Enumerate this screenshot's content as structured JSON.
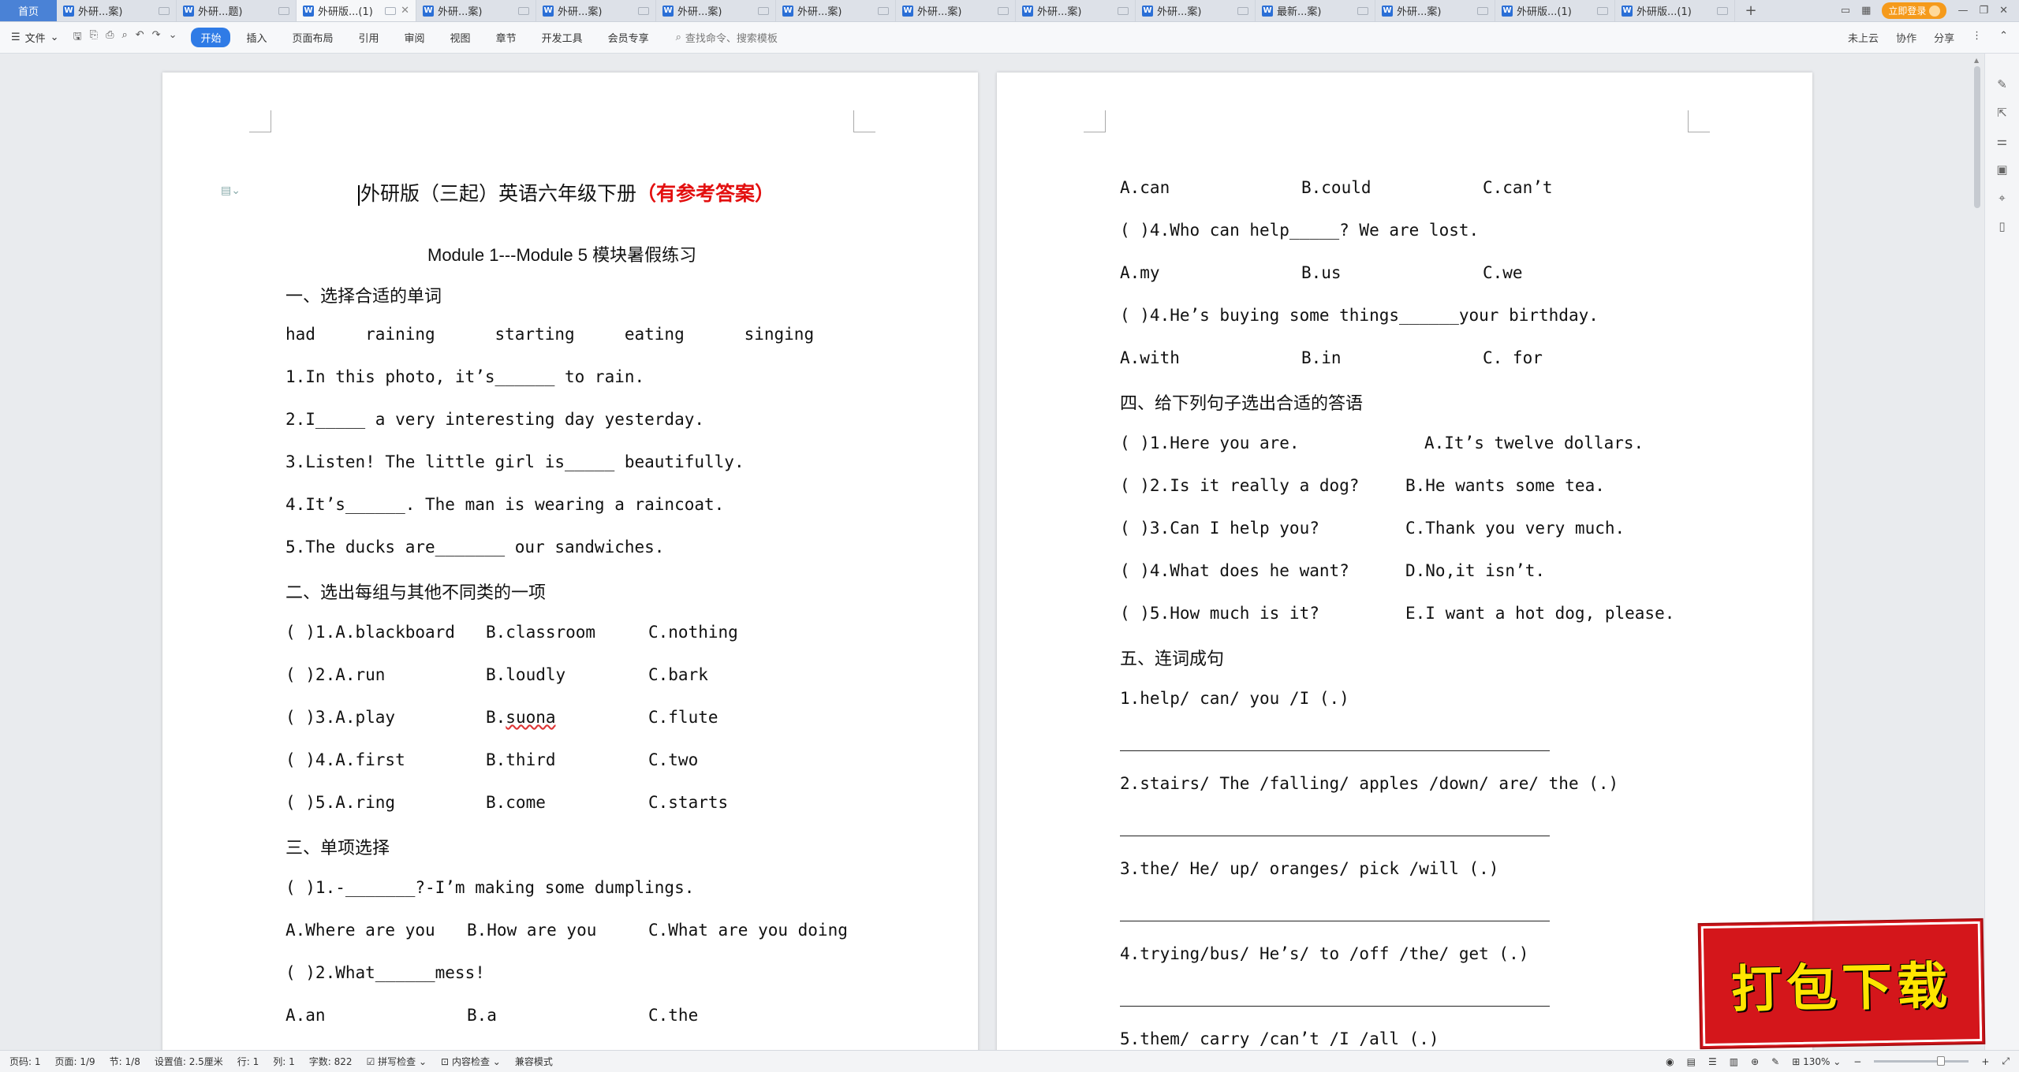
{
  "tabbar": {
    "home": "首页",
    "tabs": [
      {
        "label": "外研...案)",
        "active": false
      },
      {
        "label": "外研...题)",
        "active": false
      },
      {
        "label": "外研版...(1)",
        "active": true
      },
      {
        "label": "外研...案)",
        "active": false
      },
      {
        "label": "外研...案)",
        "active": false
      },
      {
        "label": "外研...案)",
        "active": false
      },
      {
        "label": "外研...案)",
        "active": false
      },
      {
        "label": "外研...案)",
        "active": false
      },
      {
        "label": "外研...案)",
        "active": false
      },
      {
        "label": "外研...案)",
        "active": false
      },
      {
        "label": "最新...案)",
        "active": false
      },
      {
        "label": "外研...案)",
        "active": false
      },
      {
        "label": "外研版...(1)",
        "active": false
      },
      {
        "label": "外研版...(1)",
        "active": false
      }
    ],
    "plus": "+",
    "login": "立即登录"
  },
  "ribbon": {
    "file": "文件",
    "tabs": [
      "开始",
      "插入",
      "页面布局",
      "引用",
      "审阅",
      "视图",
      "章节",
      "开发工具",
      "会员专享"
    ],
    "active_tab": "开始",
    "search": "查找命令、搜索模板",
    "right": [
      "未上云",
      "协作",
      "分享"
    ]
  },
  "page1": {
    "title_main": "外研版（三起）英语六年级下册",
    "title_red": "（有参考答案）",
    "subtitle": "Module 1---Module 5 模块暑假练习",
    "sec1": "一、选择合适的单词",
    "wordbank": "had     raining      starting     eating      singing",
    "q1": [
      "1.In this photo, it’s______ to rain.",
      "2.I_____ a very interesting day yesterday.",
      "3.Listen! The little girl is_____ beautifully.",
      "4.It’s______. The man is wearing a raincoat.",
      "5.The ducks are_______ our sandwiches."
    ],
    "sec2": "二、选出每组与其他不同类的一项",
    "q2": [
      [
        "( )1.A.blackboard",
        "B.classroom",
        "C.nothing"
      ],
      [
        "( )2.A.run",
        "B.loudly",
        "C.bark"
      ],
      [
        "( )3.A.play",
        "B.suona",
        "C.flute"
      ],
      [
        "( )4.A.first",
        "B.third",
        "C.two"
      ],
      [
        "( )5.A.ring",
        "B.come",
        "C.starts"
      ]
    ],
    "sec3": "三、单项选择",
    "q3_1": "( )1.-_______?-I’m making some dumplings.",
    "q3_1_opts": [
      "A.Where are you",
      "B.How are you",
      "C.What are you doing"
    ],
    "q3_2": "( )2.What______mess!",
    "q3_2_opts": [
      "A.an",
      "B.a",
      "C.the"
    ]
  },
  "page2": {
    "p2_opts1": [
      "A.can",
      "B.could",
      "C.can’t"
    ],
    "q4": "( )4.Who can help_____? We are lost.",
    "p2_opts2": [
      "A.my",
      "B.us",
      "C.we"
    ],
    "q5": "( )4.He’s buying some things______your birthday.",
    "p2_opts3": [
      "A.with",
      "B.in",
      "C. for"
    ],
    "sec4": "四、给下列句子选出合适的答语",
    "match": [
      [
        "( )1.Here you are.",
        "A.It’s twelve dollars."
      ],
      [
        "( )2.Is it really a dog?",
        "B.He wants some tea."
      ],
      [
        "( )3.Can I help you?",
        "C.Thank you very much."
      ],
      [
        "( )4.What does he want?",
        "D.No,it isn’t."
      ],
      [
        "( )5.How much is it?",
        "E.I want a hot dog, please."
      ]
    ],
    "sec5": "五、连词成句",
    "sentences": [
      "1.help/ can/ you /I (.)",
      "2.stairs/ The /falling/ apples /down/ are/ the (.)",
      "3.the/ He/ up/ oranges/ pick /will (.)",
      "4.trying/bus/ He’s/ to /off /the/ get (.)",
      "5.them/ carry /can’t /I /all (.)"
    ]
  },
  "statusbar": {
    "page_code": "页码: 1",
    "pages": "页面: 1/9",
    "section": "节: 1/8",
    "setting": "设置值: 2.5厘米",
    "row": "行: 1",
    "col": "列: 1",
    "words": "字数: 822",
    "spell": "拼写检查",
    "content": "内容检查",
    "compat": "兼容模式",
    "zoom": "130%"
  },
  "stamp": "打包下载"
}
